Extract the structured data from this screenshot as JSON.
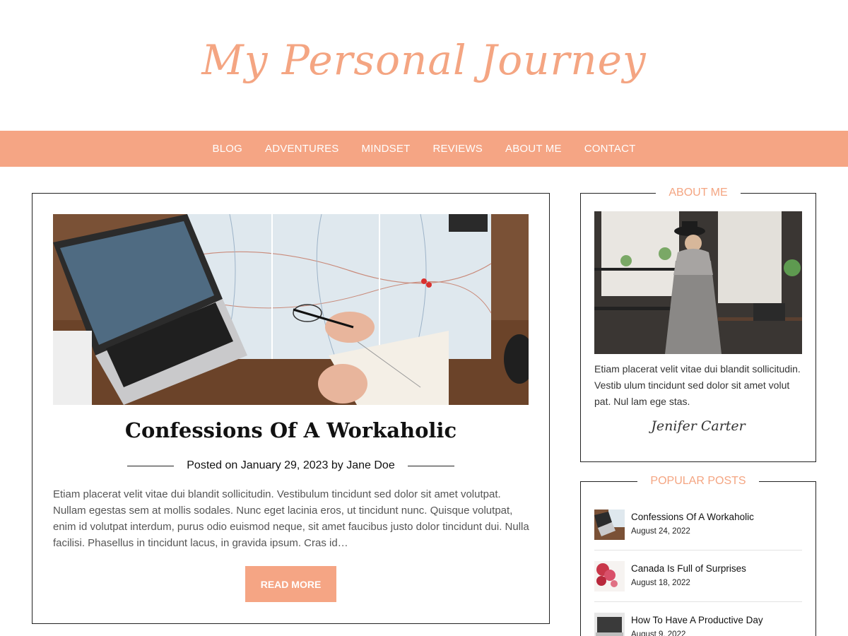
{
  "site": {
    "title": "My Personal Journey",
    "accent": "#f5a584"
  },
  "nav": {
    "items": [
      "BLOG",
      "ADVENTURES",
      "MINDSET",
      "REVIEWS",
      "ABOUT ME",
      "CONTACT"
    ]
  },
  "post": {
    "title": "Confessions Of A Workaholic",
    "meta_prefix": "Posted on",
    "date": "January 29, 2023",
    "meta_by": "by",
    "author": "Jane Doe",
    "excerpt": "Etiam placerat velit vitae dui blandit sollicitudin. Vestibulum tincidunt sed dolor sit amet volutpat. Nullam egestas sem at mollis sodales. Nunc eget lacinia eros, ut tincidunt nunc. Quisque volutpat, enim id volutpat interdum, purus odio euismod neque, sit amet faucibus justo dolor tincidunt dui. Nulla facilisi. Phasellus in tincidunt lacus, in gravida ipsum. Cras id…",
    "read_more": "READ MORE"
  },
  "about": {
    "heading": "ABOUT ME",
    "text": "Etiam placerat velit vitae dui blandit sollicitudin. Vestib ulum tincidunt sed dolor sit amet volut pat. Nul lam ege stas.",
    "signature": "Jenifer Carter"
  },
  "popular": {
    "heading": "POPULAR POSTS",
    "items": [
      {
        "title": "Confessions Of A Workaholic",
        "date": "August 24, 2022"
      },
      {
        "title": "Canada Is Full of Surprises",
        "date": "August 18, 2022"
      },
      {
        "title": "How To Have A Productive Day",
        "date": "August 9, 2022"
      }
    ]
  }
}
